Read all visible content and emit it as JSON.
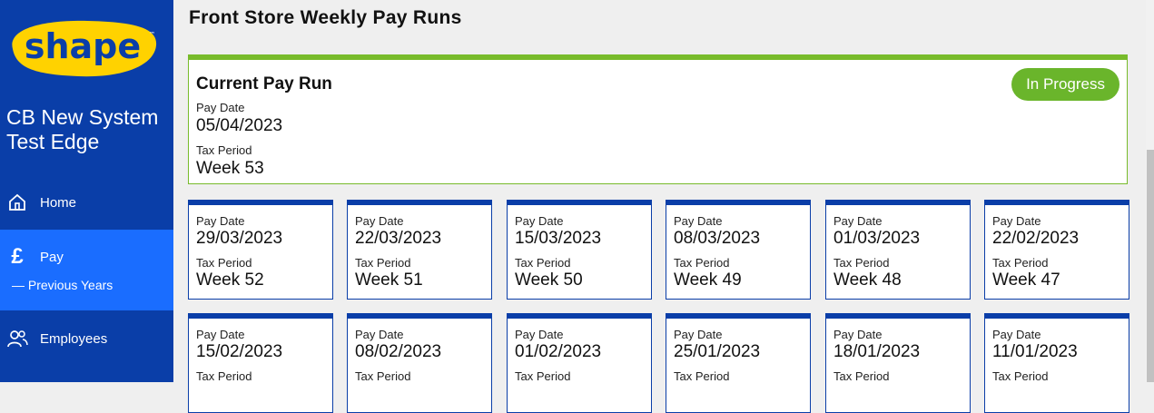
{
  "brand": {
    "logo_text": "shape",
    "trademark": "™"
  },
  "company": {
    "name": "CB New System Test Edge"
  },
  "nav": {
    "home_label": "Home",
    "pay_label": "Pay",
    "pay_sub_label": "— Previous Years",
    "employees_label": "Employees"
  },
  "page": {
    "title": "Front Store Weekly Pay Runs"
  },
  "current_run": {
    "heading": "Current Pay Run",
    "status": "In Progress",
    "pay_date_label": "Pay Date",
    "pay_date": "05/04/2023",
    "tax_period_label": "Tax Period",
    "tax_period": "Week 53"
  },
  "runs": [
    {
      "pay_date_label": "Pay Date",
      "pay_date": "29/03/2023",
      "tax_period_label": "Tax Period",
      "tax_period": "Week 52"
    },
    {
      "pay_date_label": "Pay Date",
      "pay_date": "22/03/2023",
      "tax_period_label": "Tax Period",
      "tax_period": "Week 51"
    },
    {
      "pay_date_label": "Pay Date",
      "pay_date": "15/03/2023",
      "tax_period_label": "Tax Period",
      "tax_period": "Week 50"
    },
    {
      "pay_date_label": "Pay Date",
      "pay_date": "08/03/2023",
      "tax_period_label": "Tax Period",
      "tax_period": "Week 49"
    },
    {
      "pay_date_label": "Pay Date",
      "pay_date": "01/03/2023",
      "tax_period_label": "Tax Period",
      "tax_period": "Week 48"
    },
    {
      "pay_date_label": "Pay Date",
      "pay_date": "22/02/2023",
      "tax_period_label": "Tax Period",
      "tax_period": "Week 47"
    },
    {
      "pay_date_label": "Pay Date",
      "pay_date": "15/02/2023",
      "tax_period_label": "Tax Period",
      "tax_period": ""
    },
    {
      "pay_date_label": "Pay Date",
      "pay_date": "08/02/2023",
      "tax_period_label": "Tax Period",
      "tax_period": ""
    },
    {
      "pay_date_label": "Pay Date",
      "pay_date": "01/02/2023",
      "tax_period_label": "Tax Period",
      "tax_period": ""
    },
    {
      "pay_date_label": "Pay Date",
      "pay_date": "25/01/2023",
      "tax_period_label": "Tax Period",
      "tax_period": ""
    },
    {
      "pay_date_label": "Pay Date",
      "pay_date": "18/01/2023",
      "tax_period_label": "Tax Period",
      "tax_period": ""
    },
    {
      "pay_date_label": "Pay Date",
      "pay_date": "11/01/2023",
      "tax_period_label": "Tax Period",
      "tax_period": ""
    }
  ],
  "colors": {
    "sidebar": "#0a3ea8",
    "sidebar_active": "#1a6dff",
    "logo_yellow": "#ffd200",
    "current_accent": "#78bb2b",
    "badge": "#6ab52b",
    "card_accent": "#0a3ea8"
  },
  "icons": {
    "home": "home-icon",
    "pay": "pound-icon",
    "employees": "people-icon"
  }
}
